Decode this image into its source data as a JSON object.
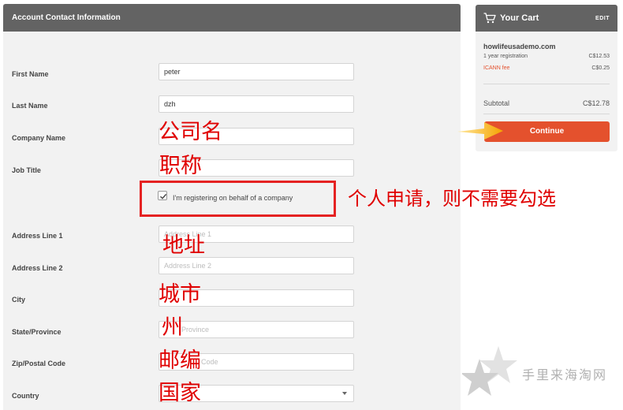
{
  "form": {
    "header_title": "Account Contact Information",
    "rows": [
      {
        "label": "First Name",
        "value": "peter",
        "placeholder": ""
      },
      {
        "label": "Last Name",
        "value": "dzh",
        "placeholder": ""
      },
      {
        "label": "Company Name",
        "value": "",
        "placeholder": ""
      },
      {
        "label": "Job Title",
        "value": "",
        "placeholder": ""
      },
      {
        "label": "Address Line 1",
        "value": "",
        "placeholder": "Address Line 1"
      },
      {
        "label": "Address Line 2",
        "value": "",
        "placeholder": "Address Line 2"
      },
      {
        "label": "City",
        "value": "",
        "placeholder": ""
      },
      {
        "label": "State/Province",
        "value": "",
        "placeholder": "Province"
      },
      {
        "label": "Zip/Postal Code",
        "value": "",
        "placeholder": "Code"
      },
      {
        "label": "Country",
        "value": "",
        "placeholder": ""
      }
    ],
    "checkbox_label": "I'm registering on behalf of a company",
    "checkbox_checked": true
  },
  "annotations": {
    "company_name": "公司名",
    "job_title": "职称",
    "checkbox_note": "个人申请，则不需要勾选",
    "address": "地址",
    "city": "城市",
    "state": "州",
    "zip": "邮编",
    "country": "国家"
  },
  "cart": {
    "title": "Your Cart",
    "edit_label": "EDIT",
    "domain": "howlifeusademo.com",
    "registration_label": "1 year registration",
    "registration_price": "C$12.53",
    "icann_label": "ICANN fee",
    "icann_price": "C$0.25",
    "subtotal_label": "Subtotal",
    "subtotal_price": "C$12.78",
    "continue_label": "Continue"
  },
  "watermark": {
    "text": "手里来海淘网"
  },
  "colors": {
    "header_bg": "#636363",
    "panel_bg": "#f2f2f2",
    "accent": "#e4512d",
    "annotation_red": "#e00000"
  }
}
